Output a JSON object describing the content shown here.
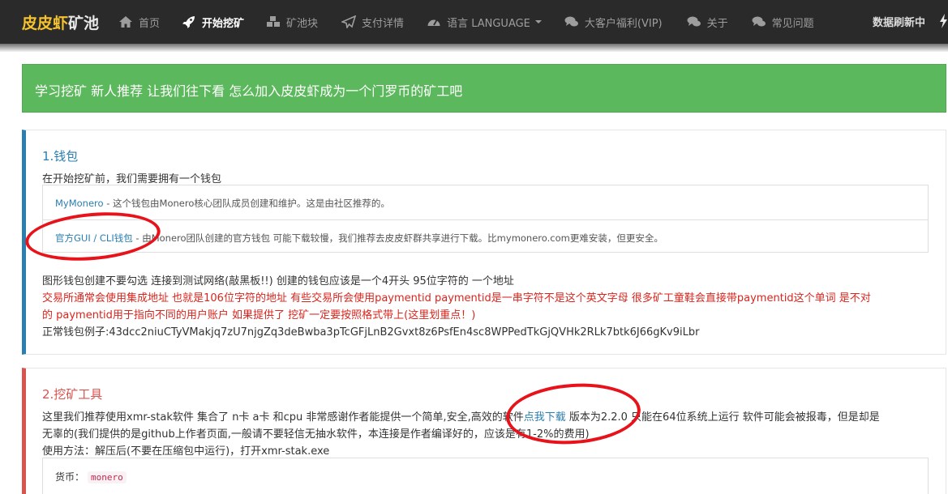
{
  "nav": {
    "brand_part1": "皮皮虾",
    "brand_part2": "矿池",
    "items": [
      {
        "label": "首页",
        "icon": "home-icon"
      },
      {
        "label": "开始挖矿",
        "icon": "rocket-icon"
      },
      {
        "label": "矿池块",
        "icon": "cubes-icon"
      },
      {
        "label": "支付详情",
        "icon": "paper-plane-icon"
      },
      {
        "label": "语言 LANGUAGE",
        "icon": "dashboard-icon"
      },
      {
        "label": "大客户福利(VIP)",
        "icon": "comments-icon"
      },
      {
        "label": "关于",
        "icon": "comments-icon"
      },
      {
        "label": "常见问题",
        "icon": "comments-icon"
      }
    ],
    "refresh_label": "数据刷新中",
    "refresh_icon": "bolt-icon"
  },
  "banner": {
    "text": "学习挖矿 新人推荐 让我们往下看 怎么加入皮皮虾成为一个门罗币的矿工吧"
  },
  "wallet": {
    "title": "1.钱包",
    "intro": "在开始挖矿前，我们需要拥有一个钱包",
    "options": [
      {
        "link": "MyMonero",
        "desc": " - 这个钱包由Monero核心团队成员创建和维护。这是由社区推荐的。"
      },
      {
        "link": "官方GUI / CLI钱包",
        "desc": " - 由Monero团队创建的官方钱包 可能下载较慢，我们推荐去皮皮虾群共享进行下载。比mymonero.com更难安装，但更安全。"
      }
    ],
    "note": "图形钱包创建不要勾选 连接到测试网络(敲黑板!!) 创建的钱包应该是一个4开头 95位字符的 一个地址",
    "warning_line1": "交易所通常会使用集成地址 也就是106位字符的地址 有些交易所会使用paymentid paymentid是一串字符不是这个英文字母 很多矿工童鞋会直接带paymentid这个单词 是不对",
    "warning_line2": "的 paymentid用于指向不同的用户账户 如果提供了 挖矿一定要按照格式带上(这里划重点！)",
    "example_label": "正常钱包例子:",
    "example_address": "43dcc2niuCTyVMakjq7zU7njgZq3deBwba3pTcGFjLnB2Gvxt8z6PsfEn4sc8WPPedTkGjQVHk2RLk7btk6J66gKv9iLbr"
  },
  "tools": {
    "title": "2.挖矿工具",
    "line1_pre": "这里我们推荐使用xmr-stak软件 集合了 n卡 a卡 和cpu 非常感谢作者能提供一个简单,安全,高效的软件",
    "line1_link": "点我下载",
    "line1_post": " 版本为2.2.0 只能在64位系统上运行 软件可能会被报毒，但是却是",
    "line2": "无辜的(我们提供的是github上作者页面,一般请不要轻信无抽水软件，本连接是作者编译好的，应该是有1-2%的费用)",
    "usage": "使用方法：解压后(不要在压缩包中运行)，打开xmr-stak.exe",
    "coin_label": "货币：",
    "coin_value": "monero"
  },
  "colors": {
    "navbar": "#2a2a2a",
    "brand_accent": "#f6c32e",
    "banner": "#5cb85c",
    "panel1_accent": "#2a7fb0",
    "panel2_accent": "#d9534f",
    "annotation": "#e8121b"
  }
}
